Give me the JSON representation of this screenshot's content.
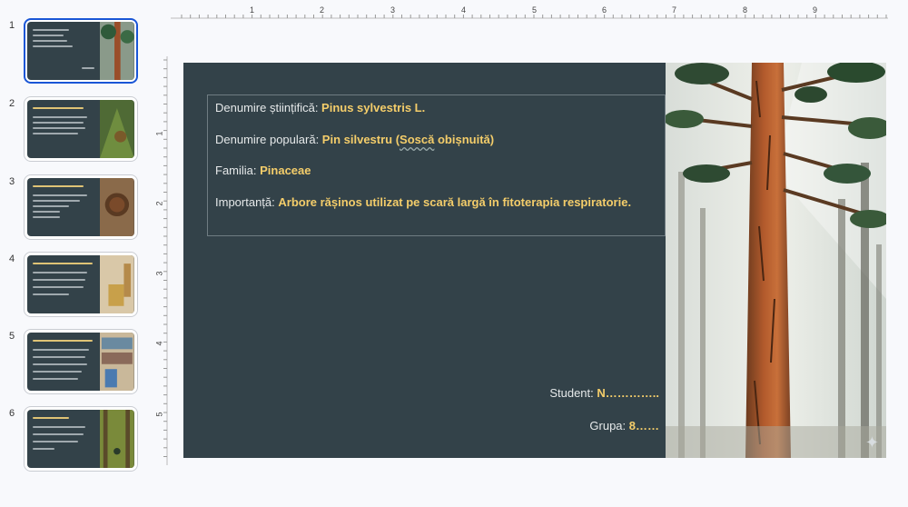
{
  "thumbnails": [
    {
      "number": "1",
      "selected": true
    },
    {
      "number": "2",
      "selected": false
    },
    {
      "number": "3",
      "selected": false
    },
    {
      "number": "4",
      "selected": false
    },
    {
      "number": "5",
      "selected": false
    },
    {
      "number": "6",
      "selected": false
    }
  ],
  "thumb_numbers": [
    "1",
    "2",
    "3",
    "4",
    "5",
    "6"
  ],
  "ruler": {
    "top": [
      "1",
      "2",
      "3",
      "4",
      "5",
      "6",
      "7",
      "8",
      "9"
    ],
    "left": [
      "1",
      "2",
      "3",
      "4",
      "5"
    ]
  },
  "slide": {
    "scientific_label": "Denumire științifică: ",
    "scientific_value": "Pinus sylvestris L.",
    "popular_label": "Denumire populară: ",
    "popular_value_a": "Pin silvestru (",
    "popular_value_b": "Soscă",
    "popular_value_c": " obișnuită)",
    "family_label": "Familia: ",
    "family_value": "Pinaceae",
    "importance_label": "Importanță: ",
    "importance_value": "Arbore rășinos utilizat pe scară largă în fitoterapia respiratorie.",
    "student_label": "Student: ",
    "student_value": "N…………..",
    "group_label": "Grupa: ",
    "group_value": "8……"
  },
  "colors": {
    "slide_bg": "#334249",
    "accent": "#f4cd6a",
    "selection": "#1a56d6"
  },
  "icons": {
    "sparkle": "✦"
  }
}
